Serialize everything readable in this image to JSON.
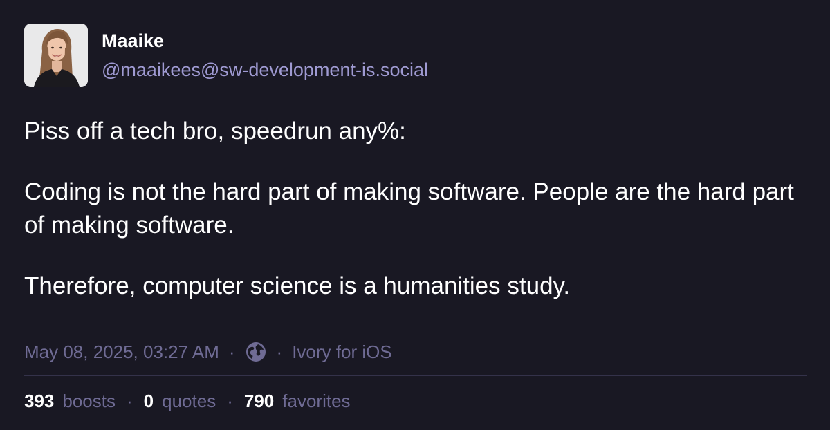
{
  "post": {
    "author": {
      "display_name": "Maaike",
      "handle": "@maaikees@sw-development-is.social"
    },
    "paragraphs": [
      "Piss off a tech bro, speedrun any%:",
      "Coding is not the hard part of making software. People are the hard part of making software.",
      "Therefore, computer science is a humanities study."
    ],
    "meta": {
      "timestamp": "May 08, 2025, 03:27 AM",
      "separator": "·",
      "visibility_icon": "globe-icon",
      "client": "Ivory for iOS"
    },
    "stats": {
      "boosts_count": "393",
      "boosts_label": "boosts",
      "quotes_count": "0",
      "quotes_label": "quotes",
      "favorites_count": "790",
      "favorites_label": "favorites",
      "separator": "·"
    }
  },
  "colors": {
    "background": "#191823",
    "text": "#ffffff",
    "handle": "#9f9ad2",
    "muted": "#6f6b94",
    "divider": "#34324a"
  }
}
